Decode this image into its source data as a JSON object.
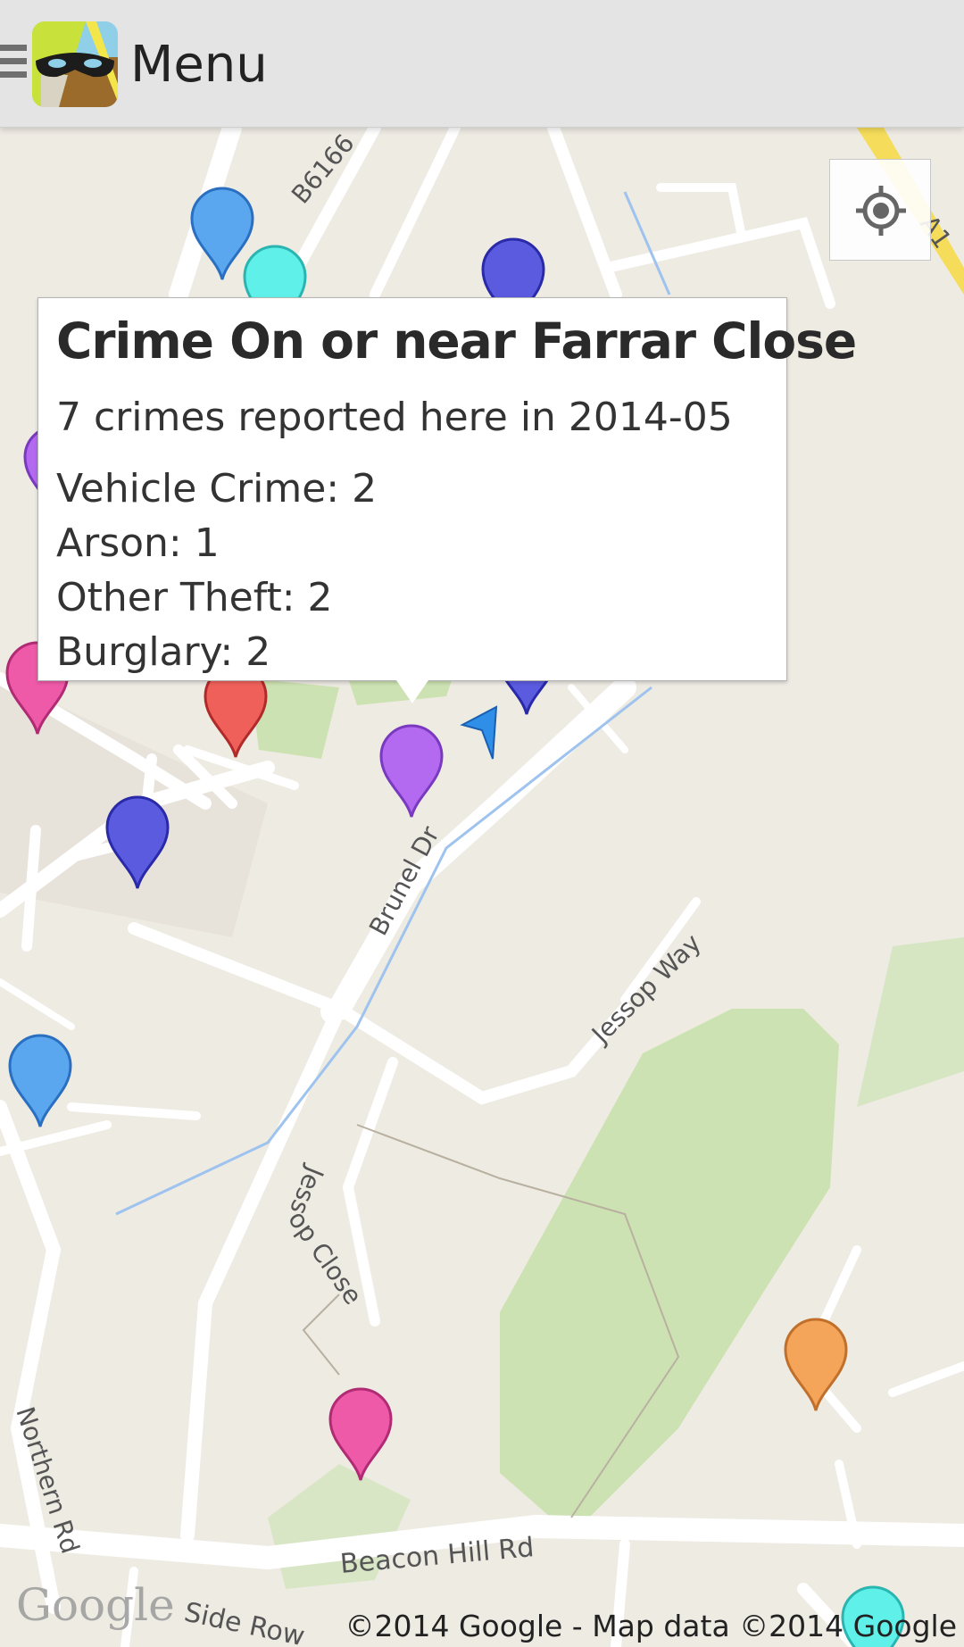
{
  "header": {
    "title": "Menu"
  },
  "map": {
    "road_labels": {
      "b6166": "B6166",
      "a1": "A1",
      "brunel_dr": "Brunel Dr",
      "jessop_way": "Jessop Way",
      "jessop_close_1": "Jess",
      "jessop_close_2": "op Close",
      "northern_rd": "Northern Rd",
      "beacon_hill_rd": "Beacon Hill Rd",
      "side_row": "Side Row"
    },
    "copyright": "©2014 Google - Map data ©2014 Google",
    "logo_text": "Google",
    "marker_colors": {
      "blue": "#5aa7f0",
      "cyan": "#5ff0ea",
      "indigo": "#5b5be0",
      "purple": "#b36af0",
      "pink": "#ef5aa8",
      "red": "#f0605a",
      "orange": "#f5a55a"
    }
  },
  "info_window": {
    "title": "Crime On or near Farrar Close",
    "summary": "7 crimes reported here in 2014-05",
    "breakdown": [
      "Vehicle Crime: 2",
      "Arson: 1",
      "Other Theft: 2",
      "Burglary: 2"
    ]
  }
}
